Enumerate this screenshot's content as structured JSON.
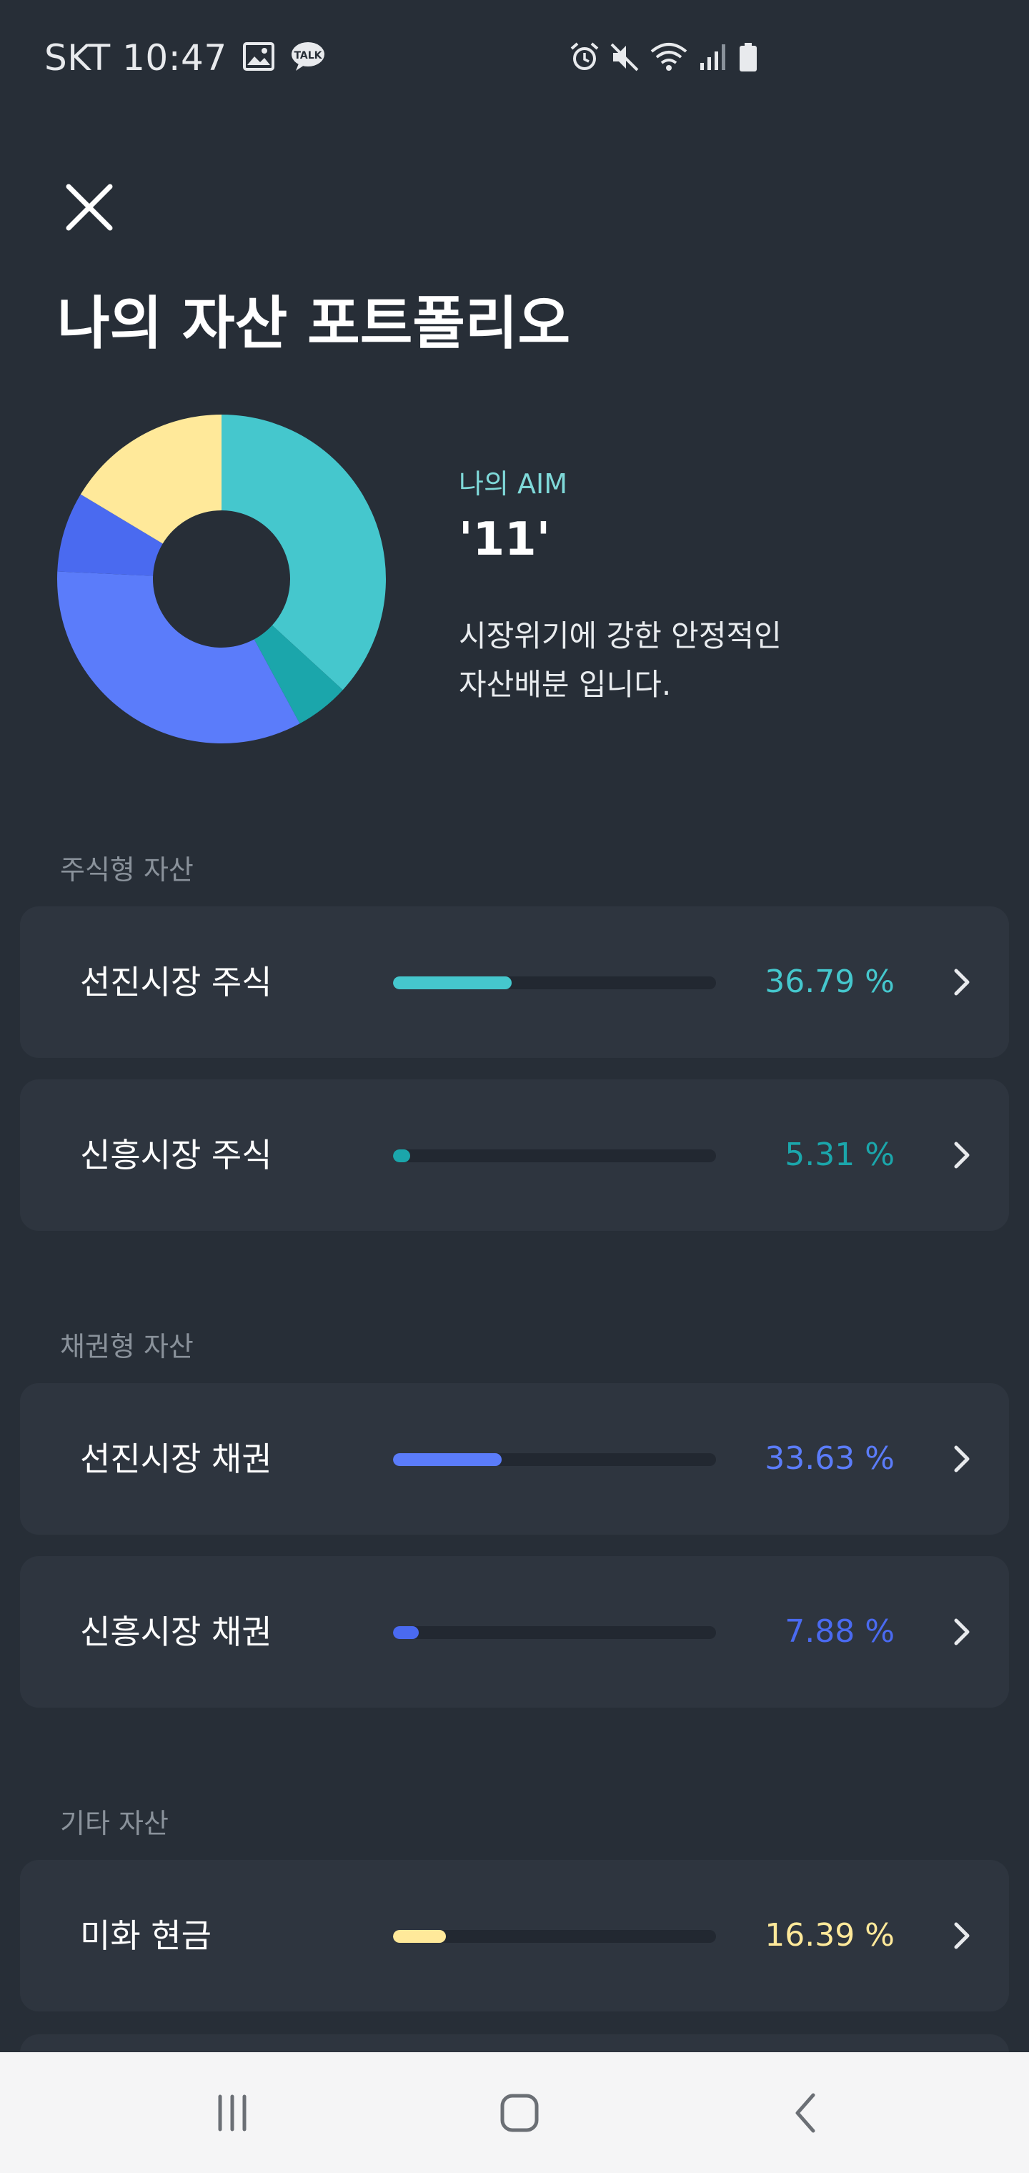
{
  "status_bar": {
    "carrier_time": "SKT 10:47",
    "icons": [
      "image-icon",
      "kakaotalk-icon",
      "alarm-icon",
      "mute-icon",
      "wifi-icon",
      "signal-icon",
      "battery-icon"
    ],
    "talk_icon_text": "TALK"
  },
  "header": {
    "close_icon": "close-icon",
    "title": "나의 자산 포트폴리오"
  },
  "aim": {
    "label": "나의 AIM",
    "value": "'11'",
    "description_line1": "시장위기에 강한 안정적인",
    "description_line2": "자산배분 입니다."
  },
  "colors": {
    "background": "#272e37",
    "card": "#2e353f",
    "teal": "#45c7cd",
    "dark_teal": "#1ba6ab",
    "blue": "#5b7cfa",
    "dark_blue": "#4a6af0",
    "yellow": "#ffe99a"
  },
  "sections": [
    {
      "label": "주식형 자산",
      "items": [
        {
          "label": "선진시장 주식",
          "percent_text": "36.79 %",
          "value": 36.79,
          "color": "#45c7cd"
        },
        {
          "label": "신흥시장 주식",
          "percent_text": "5.31 %",
          "value": 5.31,
          "color": "#1ba6ab"
        }
      ]
    },
    {
      "label": "채권형 자산",
      "items": [
        {
          "label": "선진시장 채권",
          "percent_text": "33.63 %",
          "value": 33.63,
          "color": "#5b7cfa"
        },
        {
          "label": "신흥시장 채권",
          "percent_text": "7.88 %",
          "value": 7.88,
          "color": "#4a6af0"
        }
      ]
    },
    {
      "label": "기타 자산",
      "items": [
        {
          "label": "미화 현금",
          "percent_text": "16.39 %",
          "value": 16.39,
          "color": "#ffe99a"
        }
      ]
    }
  ],
  "nav": {
    "recent_icon": "recent-apps-icon",
    "home_icon": "home-icon",
    "back_icon": "back-icon"
  }
}
